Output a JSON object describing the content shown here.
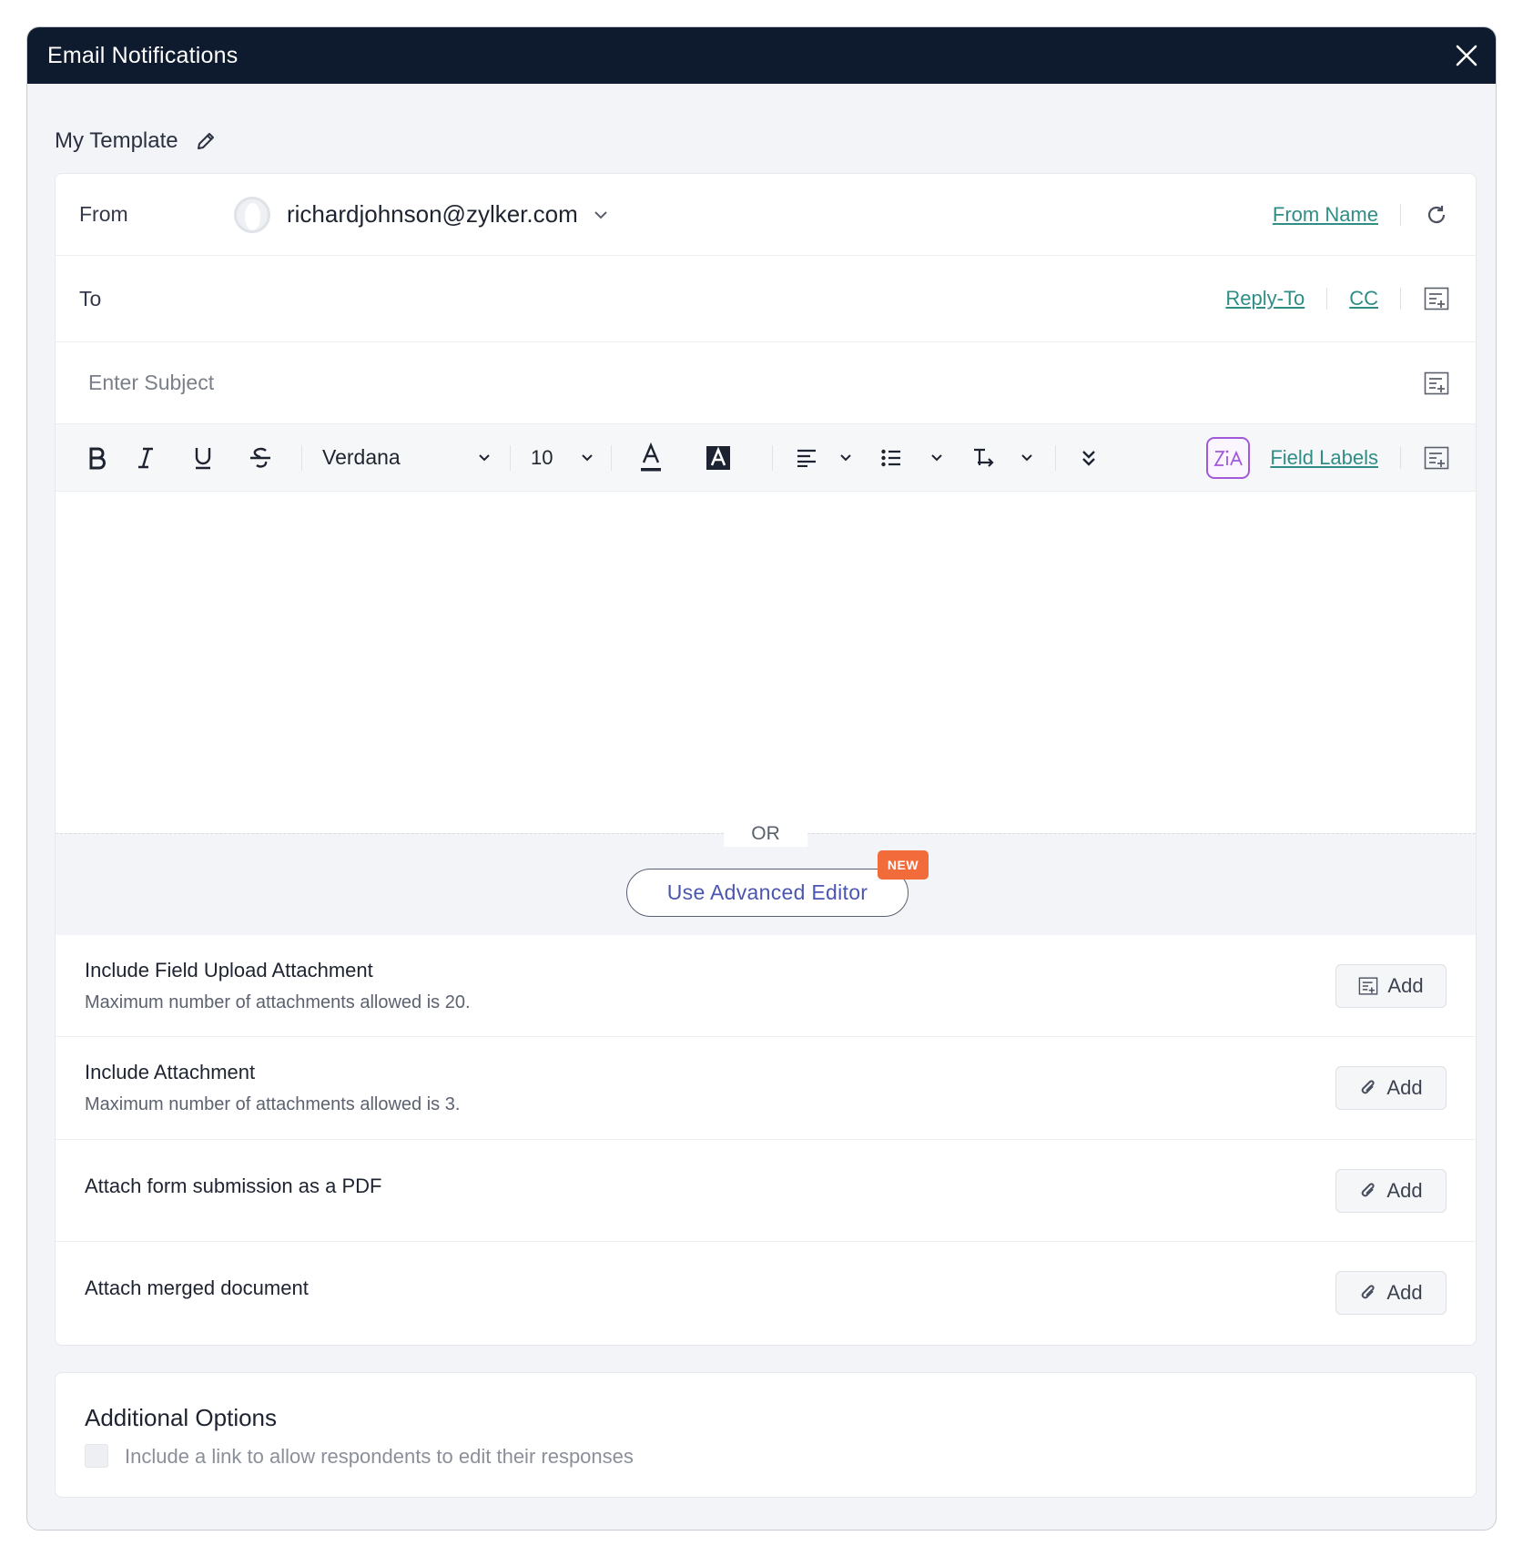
{
  "dialog": {
    "title": "Email Notifications"
  },
  "template": {
    "name": "My Template"
  },
  "from": {
    "label": "From",
    "email": "richardjohnson@zylker.com",
    "from_name_link": "From Name"
  },
  "to": {
    "label": "To",
    "reply_to_link": "Reply-To",
    "cc_link": "CC"
  },
  "subject": {
    "placeholder": "Enter Subject",
    "value": ""
  },
  "toolbar": {
    "font_family": "Verdana",
    "font_size": "10",
    "field_labels_link": "Field Labels",
    "zia_label": "Zia"
  },
  "editor": {
    "or_label": "OR",
    "advanced_editor_label": "Use Advanced Editor",
    "new_badge": "NEW"
  },
  "attachments": [
    {
      "title": "Include Field Upload Attachment",
      "subtitle": "Maximum number of attachments allowed is 20.",
      "button": "Add",
      "icon": "field-insert-icon"
    },
    {
      "title": "Include Attachment",
      "subtitle": "Maximum number of attachments allowed is 3.",
      "button": "Add",
      "icon": "paperclip-icon"
    },
    {
      "title": "Attach form submission as a PDF",
      "subtitle": "",
      "button": "Add",
      "icon": "paperclip-icon"
    },
    {
      "title": "Attach merged document",
      "subtitle": "",
      "button": "Add",
      "icon": "paperclip-icon"
    }
  ],
  "additional_options": {
    "title": "Additional Options",
    "edit_link_option": {
      "label": "Include a link to allow respondents to edit their responses",
      "checked": false
    }
  },
  "colors": {
    "titlebar": "#0e1a2e",
    "link": "#2f8d86",
    "advanced_editor_text": "#4a56b0",
    "new_badge": "#f26b3a",
    "zia_border": "#a259d9"
  }
}
